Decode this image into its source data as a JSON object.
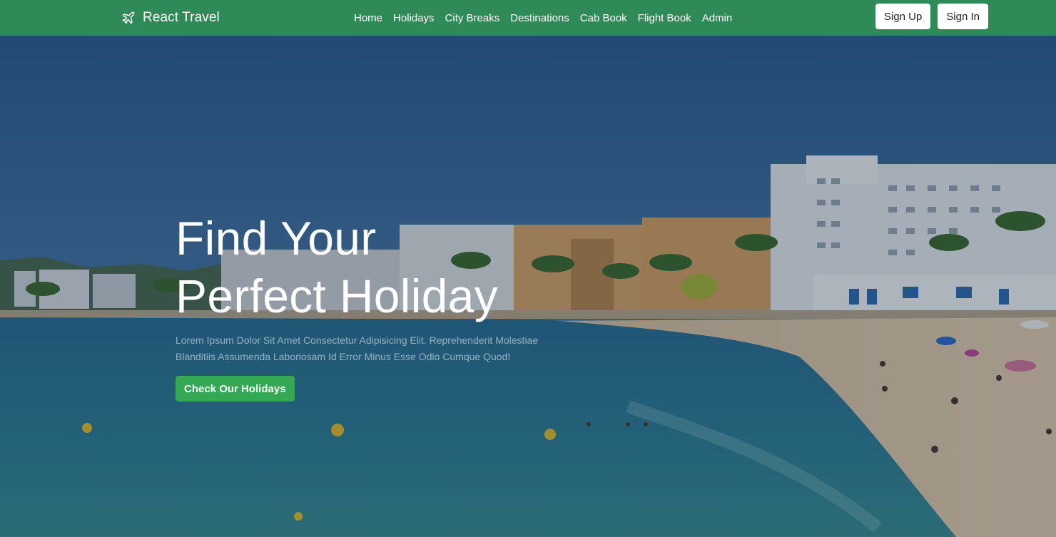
{
  "nav": {
    "brand": "React Travel",
    "links": [
      "Home",
      "Holidays",
      "City Breaks",
      "Destinations",
      "Cab Book",
      "Flight Book",
      "Admin"
    ],
    "sign_up": "Sign Up",
    "sign_in": "Sign In"
  },
  "hero": {
    "title_line1": "Find Your",
    "title_line2": "Perfect Holiday",
    "description": "Lorem Ipsum Dolor Sit Amet Consectetur Adipisicing Elit. Reprehenderit Molestiae Blanditiis Assumenda Laboriosam Id Error Minus Esse Odio Cumque Quod!",
    "cta": "Check Our Holidays"
  },
  "colors": {
    "navbar": "#2e8b57",
    "cta": "#34a853",
    "button_light": "#ffffff"
  },
  "icons": {
    "brand": "airplane-icon"
  }
}
